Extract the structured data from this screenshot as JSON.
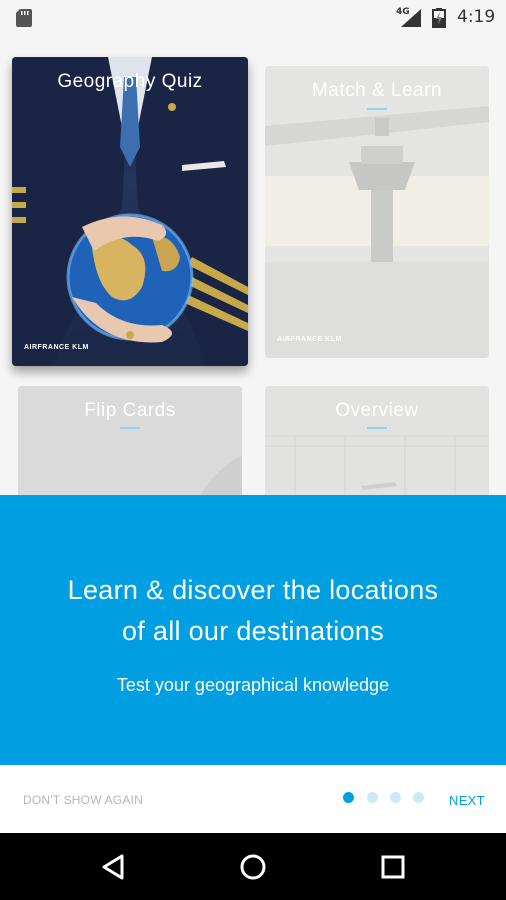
{
  "status_bar": {
    "network": "4G",
    "time": "4:19"
  },
  "cards": [
    {
      "title": "Geography Quiz",
      "brand": "AIRFRANCE KLM"
    },
    {
      "title": "Match & Learn",
      "brand": "AIRFRANCE KLM"
    },
    {
      "title": "Flip Cards"
    },
    {
      "title": "Overview"
    }
  ],
  "banner": {
    "headline_line1": "Learn & discover the locations",
    "headline_line2": "of all our destinations",
    "subline": "Test your geographical knowledge",
    "color": "#009fe2"
  },
  "footer": {
    "dont_show_label": "DON'T SHOW AGAIN",
    "next_label": "NEXT",
    "page_count": 4,
    "active_page": 1
  },
  "nav": {
    "icons": [
      "back-icon",
      "home-icon",
      "recents-icon"
    ]
  }
}
